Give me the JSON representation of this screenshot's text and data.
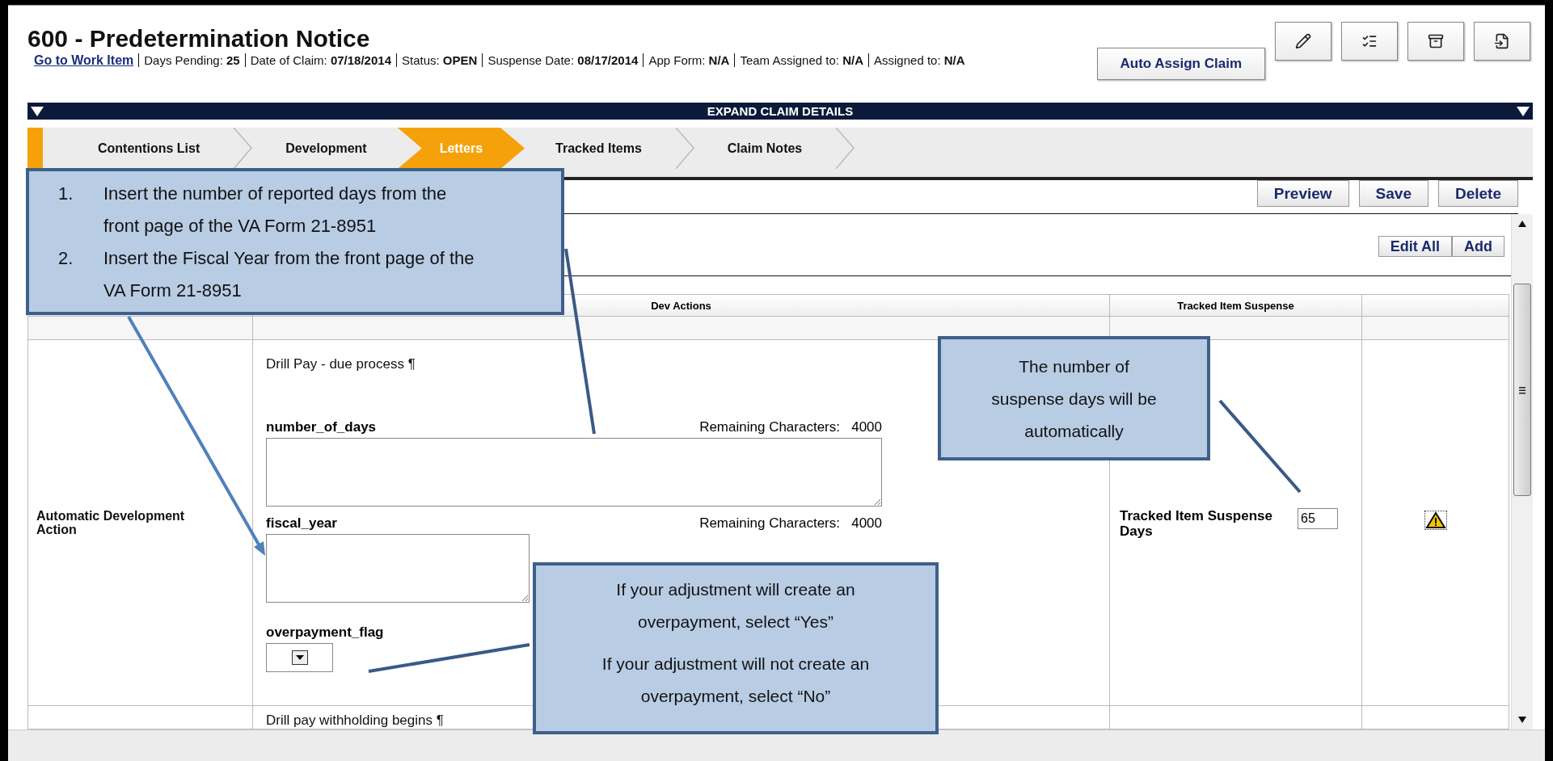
{
  "header": {
    "title": "600 - Predetermination Notice",
    "link": "Go to Work Item",
    "meta": [
      {
        "label": "Days Pending:",
        "value": "25"
      },
      {
        "label": "Date of Claim:",
        "value": "07/18/2014"
      },
      {
        "label": "Status:",
        "value": "OPEN"
      },
      {
        "label": "Suspense Date:",
        "value": "08/17/2014"
      },
      {
        "label": "App Form:",
        "value": "N/A"
      },
      {
        "label": "Team Assigned to:",
        "value": "N/A"
      },
      {
        "label": "Assigned to:",
        "value": "N/A"
      }
    ],
    "assign_button": "Auto Assign Claim",
    "tools": [
      {
        "kind": "pencil"
      },
      {
        "kind": "list"
      },
      {
        "kind": "archive"
      },
      {
        "kind": "export"
      }
    ]
  },
  "expand_bar": "EXPAND CLAIM DETAILS",
  "tabs": [
    {
      "label": "Contentions List",
      "selected": false
    },
    {
      "label": "Development",
      "selected": false
    },
    {
      "label": "Letters",
      "selected": true
    },
    {
      "label": "Tracked Items",
      "selected": false
    },
    {
      "label": "Claim Notes",
      "selected": false
    }
  ],
  "actions": [
    "Preview",
    "Save",
    "Delete"
  ],
  "list_actions": [
    "Edit All",
    "Add"
  ],
  "table": {
    "column_2": "Dev Actions",
    "column_3": "Tracked Item Suspense",
    "rows": [
      {
        "type": "Automatic Development Action",
        "title": "Drill Pay - due process ¶",
        "fields": [
          {
            "kind": "textarea",
            "name": "number_of_days",
            "remaining_label": "Remaining Characters:",
            "remaining": "4000"
          },
          {
            "kind": "textarea",
            "name": "fiscal_year",
            "remaining_label": "Remaining Characters:",
            "remaining": "4000"
          },
          {
            "kind": "select",
            "name": "overpayment_flag"
          }
        ],
        "suspense_label": "Tracked Item Suspense Days",
        "suspense_value": "65",
        "warning": true
      },
      {
        "title": "Drill pay withholding begins ¶"
      }
    ]
  },
  "callouts": [
    {
      "kind": "list",
      "items": [
        {
          "marker": "1.",
          "text": "Insert the number of reported days from the front page of the VA Form 21-8951"
        },
        {
          "marker": "2.",
          "text": "Insert the Fiscal Year from the front page of the VA Form 21-8951"
        }
      ]
    },
    {
      "kind": "text",
      "paragraphs": [
        "The number of suspense days will be automatically"
      ]
    },
    {
      "kind": "text",
      "paragraphs": [
        "If your adjustment will create an overpayment, select “Yes”",
        "If your adjustment will not create an overpayment, select “No”"
      ]
    }
  ]
}
